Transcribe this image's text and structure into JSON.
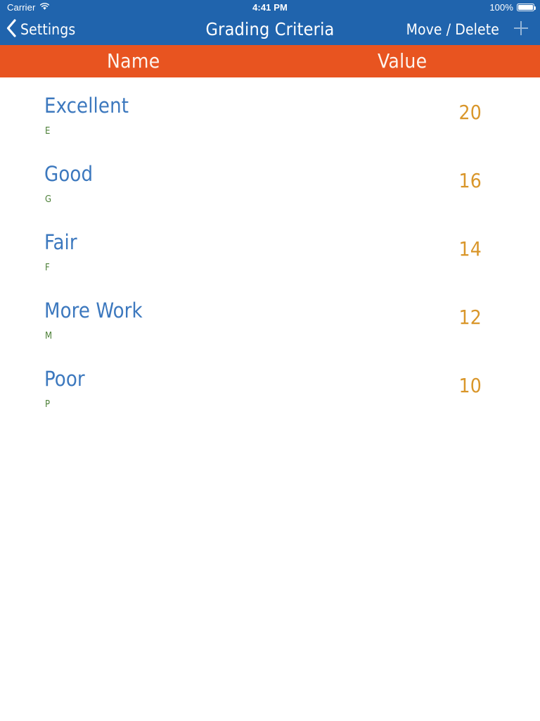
{
  "status_bar": {
    "carrier": "Carrier",
    "wifi_icon": "wifi-icon",
    "time": "4:41 PM",
    "battery_percent": "100%",
    "battery_icon": "battery-full-icon"
  },
  "nav_bar": {
    "back_icon": "chevron-left-icon",
    "back_label": "Settings",
    "title": "Grading Criteria",
    "move_delete_label": "Move / Delete",
    "add_icon": "plus-icon",
    "background_color": "#2064AD"
  },
  "column_header": {
    "name_label": "Name",
    "value_label": "Value",
    "background_color": "#E85420",
    "text_color": "#FDF4EE"
  },
  "list": {
    "title_color": "#3C78BE",
    "subtitle_color": "#4E8139",
    "value_color": "#D9962A",
    "rows": [
      {
        "title": "Excellent",
        "subtitle": "E",
        "value": "20"
      },
      {
        "title": "Good",
        "subtitle": "G",
        "value": "16"
      },
      {
        "title": "Fair",
        "subtitle": "F",
        "value": "14"
      },
      {
        "title": "More Work",
        "subtitle": "M",
        "value": "12"
      },
      {
        "title": "Poor",
        "subtitle": "P",
        "value": "10"
      }
    ]
  }
}
